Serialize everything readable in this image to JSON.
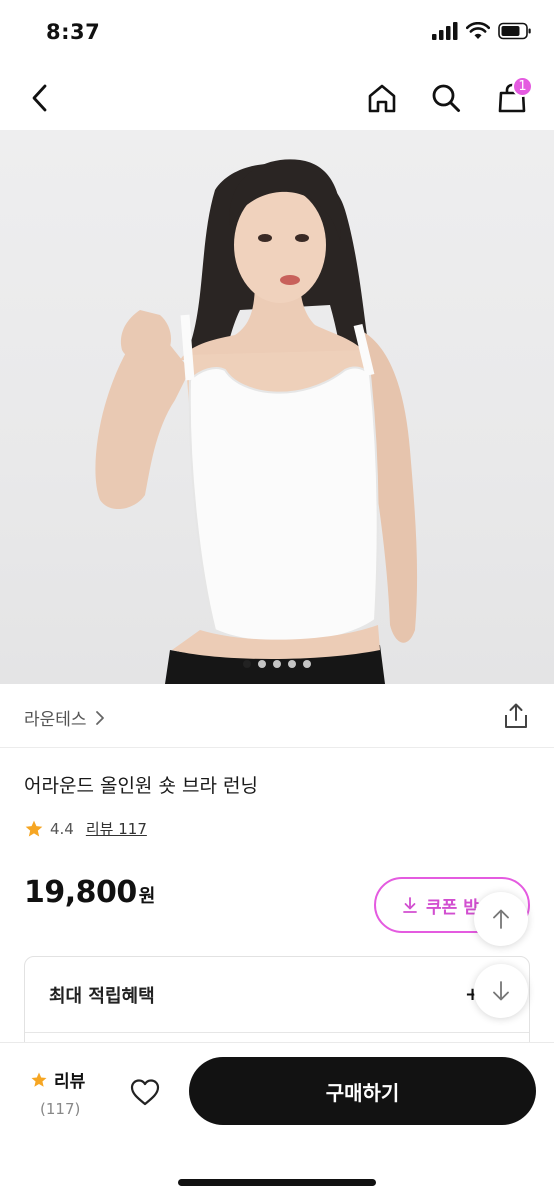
{
  "status": {
    "time": "8:37"
  },
  "nav": {
    "back_icon": "chevron-left-icon",
    "home_icon": "home-icon",
    "search_icon": "search-icon",
    "cart_icon": "shopping-bag-icon",
    "cart_badge": "1"
  },
  "gallery": {
    "slide_count": 5,
    "active_index": 0
  },
  "brand": {
    "name": "라운테스"
  },
  "product": {
    "title": "어라운드 올인원 숏 브라 런닝",
    "rating": "4.4",
    "review_link": "리뷰 117",
    "price": "19,800",
    "price_unit": "원"
  },
  "coupon": {
    "label": "쿠폰 받"
  },
  "benefit": {
    "label": "최대 적립혜택",
    "value": "+ 5"
  },
  "bottom": {
    "review_label": "리뷰",
    "review_count": "(117)",
    "buy_label": "구매하기"
  },
  "colors": {
    "accent": "#e45be0",
    "star": "#f6a623",
    "buy_button": "#121212"
  }
}
